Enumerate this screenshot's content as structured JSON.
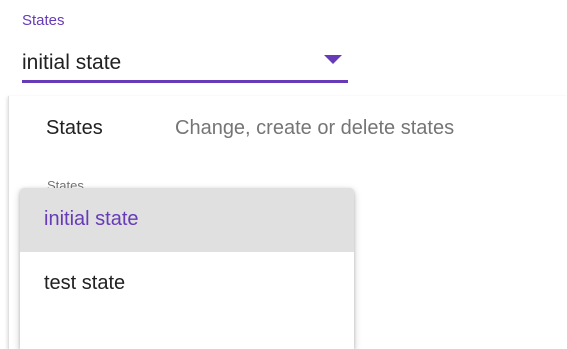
{
  "state_select": {
    "label": "States",
    "value": "initial state",
    "accent_color": "#673ab7"
  },
  "panel": {
    "title": "States",
    "description": "Change, create or delete states",
    "inner_label": "States"
  },
  "dropdown": {
    "options": [
      {
        "label": "initial state",
        "selected": true
      },
      {
        "label": "test state",
        "selected": false
      }
    ]
  }
}
